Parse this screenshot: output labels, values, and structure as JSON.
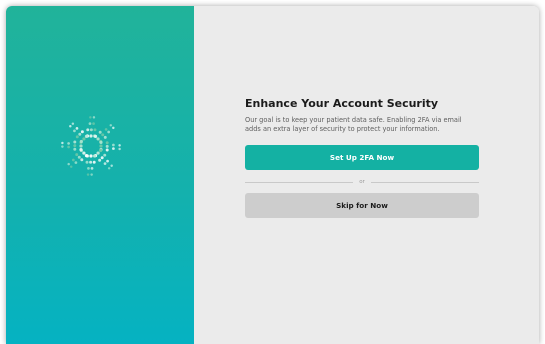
{
  "brand": {
    "logo_icon": "flower-logo-icon",
    "gradient_top": "#21b39a",
    "gradient_bottom": "#05b2c2"
  },
  "security_prompt": {
    "title": "Enhance Your Account Security",
    "description": "Our goal is to keep your patient data safe. Enabling 2FA via email adds an extra layer of security to protect your information.",
    "primary_button_label": "Set Up 2FA Now",
    "divider_text": "or",
    "secondary_button_label": "Skip for Now"
  },
  "colors": {
    "accent": "#14b1a3",
    "background": "#ebebeb",
    "secondary_button": "#cdcdcd"
  }
}
